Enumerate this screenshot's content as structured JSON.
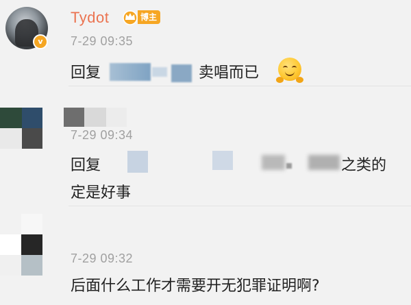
{
  "comments": [
    {
      "username": "Tydot",
      "badge": "博主",
      "verified_mark": "v",
      "timestamp": "7-29 09:35",
      "reply_prefix": "回复",
      "text": "卖唱而已",
      "emoji": "hug-emoji"
    },
    {
      "timestamp": "7-29 09:34",
      "reply_prefix": "回复",
      "text_fragment": "之类的",
      "text_line2": "定是好事"
    },
    {
      "timestamp": "7-29 09:32",
      "text": "后面什么工作才需要开无犯罪证明啊?"
    }
  ],
  "colors": {
    "username": "#eb7350",
    "badge": "#f6a623",
    "timestamp": "#a0a0a0",
    "text": "#222222",
    "background": "#f2f2f2"
  }
}
